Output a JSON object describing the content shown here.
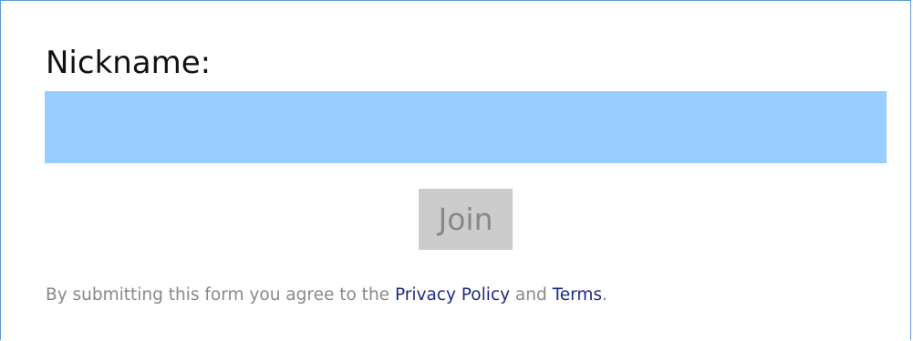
{
  "form": {
    "nickname_label": "Nickname:",
    "nickname_value": "",
    "nickname_placeholder": "",
    "join_label": "Join"
  },
  "terms": {
    "prefix": "By submitting this form you agree to the ",
    "privacy_link": "Privacy Policy",
    "conjunction": " and ",
    "terms_link": "Terms",
    "suffix": "."
  },
  "colors": {
    "input_background": "#99ccff",
    "button_background": "#cccccc",
    "button_text": "#888888",
    "link": "#1f2a80",
    "frame_border": "#5b9bd5"
  }
}
